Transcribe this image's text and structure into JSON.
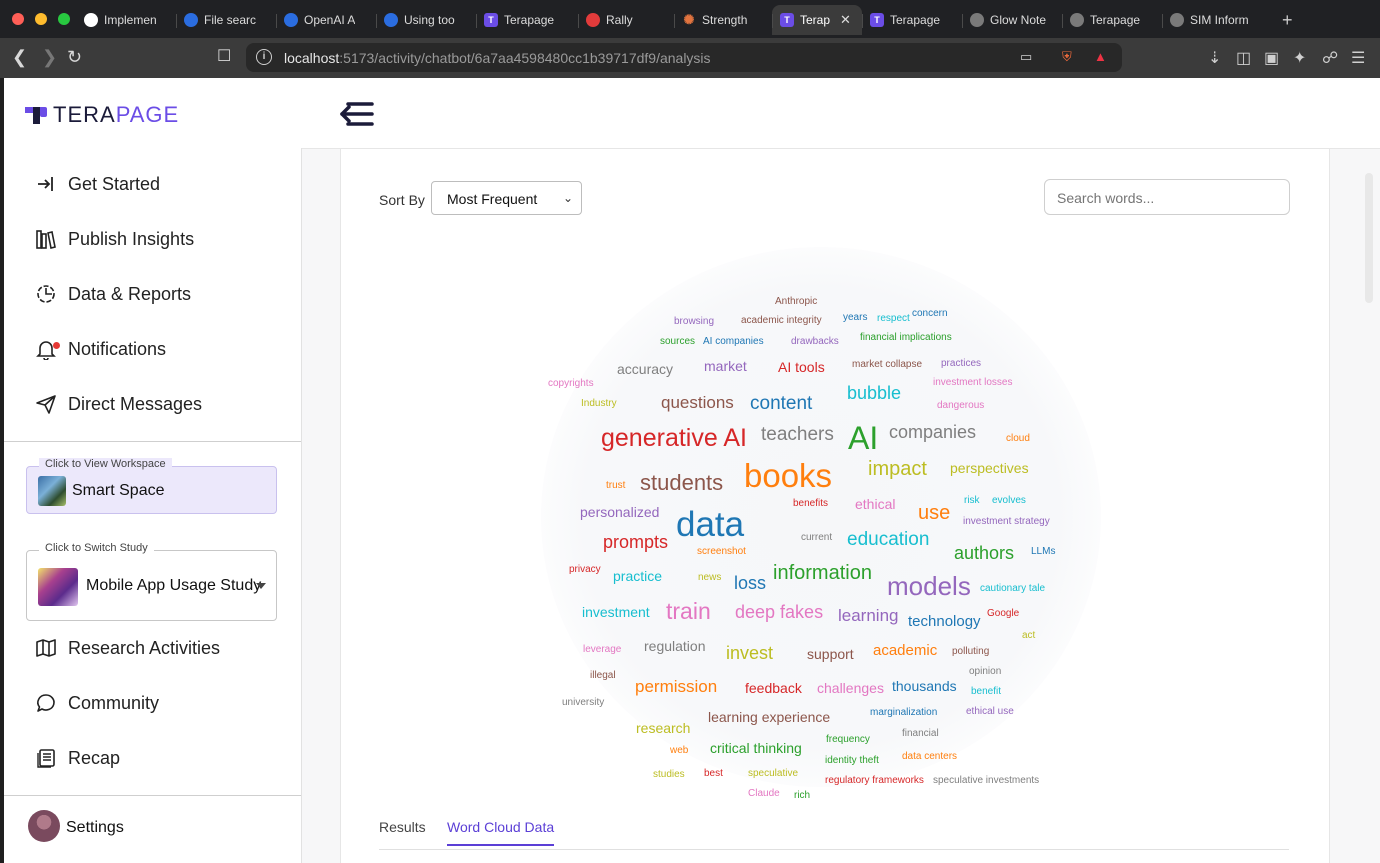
{
  "browser": {
    "tabs": [
      {
        "label": "Implemen",
        "icon": "github",
        "active": false
      },
      {
        "label": "File searc",
        "icon": "openai",
        "active": false
      },
      {
        "label": "OpenAI A",
        "icon": "openai",
        "active": false
      },
      {
        "label": "Using too",
        "icon": "openai",
        "active": false
      },
      {
        "label": "Terapage",
        "icon": "terapage",
        "active": false
      },
      {
        "label": "Rally",
        "icon": "rally",
        "active": false
      },
      {
        "label": "Strength",
        "icon": "claude",
        "active": false
      },
      {
        "label": "Terap",
        "icon": "terapage",
        "active": true
      },
      {
        "label": "Terapage",
        "icon": "terapage",
        "active": false
      },
      {
        "label": "Glow Note",
        "icon": "globe",
        "active": false
      },
      {
        "label": "Terapage",
        "icon": "globe",
        "active": false
      },
      {
        "label": "SIM Inform",
        "icon": "globe",
        "active": false
      }
    ],
    "new_tab": "+",
    "url_host": "localhost",
    "url_rest": ":5173/activity/chatbot/6a7aa4598480cc1b39717df9/analysis"
  },
  "header": {
    "logo_prefix": "TERA",
    "logo_suffix": "PAGE"
  },
  "sidebar": {
    "items": [
      {
        "label": "Get Started",
        "icon": "login-arrow-icon"
      },
      {
        "label": "Publish Insights",
        "icon": "books-icon"
      },
      {
        "label": "Data & Reports",
        "icon": "chart-pie-icon"
      },
      {
        "label": "Notifications",
        "icon": "bell-icon"
      },
      {
        "label": "Direct Messages",
        "icon": "send-icon"
      }
    ],
    "workspace_legend": "Click to View Workspace",
    "workspace_name": "Smart Space",
    "study_legend": "Click to Switch Study",
    "study_name": "Mobile App Usage Study",
    "items2": [
      {
        "label": "Research Activities",
        "icon": "map-icon"
      },
      {
        "label": "Community",
        "icon": "chat-bubble-icon"
      },
      {
        "label": "Recap",
        "icon": "recap-icon"
      }
    ],
    "settings_label": "Settings"
  },
  "toolbar": {
    "sort_label": "Sort By",
    "sort_value": "Most Frequent",
    "search_placeholder": "Search words..."
  },
  "content_tabs": {
    "results": "Results",
    "word_cloud_data": "Word Cloud Data"
  },
  "word_cloud": {
    "words": [
      {
        "text": "Anthropic",
        "size": 10,
        "color": "#8c564b"
      },
      {
        "text": "browsing",
        "size": 10,
        "color": "#9467bd"
      },
      {
        "text": "academic integrity",
        "size": 10,
        "color": "#8c564b"
      },
      {
        "text": "years",
        "size": 10,
        "color": "#1f77b4"
      },
      {
        "text": "respect",
        "size": 10,
        "color": "#17becf"
      },
      {
        "text": "concern",
        "size": 10,
        "color": "#1f77b4"
      },
      {
        "text": "sources",
        "size": 10,
        "color": "#2ca02c"
      },
      {
        "text": "AI companies",
        "size": 10,
        "color": "#1f77b4"
      },
      {
        "text": "drawbacks",
        "size": 10,
        "color": "#9467bd"
      },
      {
        "text": "financial implications",
        "size": 10,
        "color": "#2ca02c"
      },
      {
        "text": "accuracy",
        "size": 14,
        "color": "#7f7f7f"
      },
      {
        "text": "market",
        "size": 14,
        "color": "#9467bd"
      },
      {
        "text": "AI tools",
        "size": 14,
        "color": "#d62728"
      },
      {
        "text": "market collapse",
        "size": 10,
        "color": "#8c564b"
      },
      {
        "text": "practices",
        "size": 10,
        "color": "#9467bd"
      },
      {
        "text": "copyrights",
        "size": 10,
        "color": "#e377c2"
      },
      {
        "text": "investment losses",
        "size": 10,
        "color": "#e377c2"
      },
      {
        "text": "Industry",
        "size": 10,
        "color": "#bcbd22"
      },
      {
        "text": "questions",
        "size": 17,
        "color": "#8c564b"
      },
      {
        "text": "content",
        "size": 19,
        "color": "#1f77b4"
      },
      {
        "text": "bubble",
        "size": 18,
        "color": "#17becf"
      },
      {
        "text": "dangerous",
        "size": 10,
        "color": "#e377c2"
      },
      {
        "text": "generative AI",
        "size": 25,
        "color": "#d62728"
      },
      {
        "text": "teachers",
        "size": 19,
        "color": "#7f7f7f"
      },
      {
        "text": "AI",
        "size": 32,
        "color": "#2ca02c"
      },
      {
        "text": "companies",
        "size": 18,
        "color": "#7f7f7f"
      },
      {
        "text": "cloud",
        "size": 10,
        "color": "#ff7f0e"
      },
      {
        "text": "books",
        "size": 33,
        "color": "#ff7f0e"
      },
      {
        "text": "impact",
        "size": 20,
        "color": "#bcbd22"
      },
      {
        "text": "perspectives",
        "size": 14,
        "color": "#bcbd22"
      },
      {
        "text": "trust",
        "size": 10,
        "color": "#ff7f0e"
      },
      {
        "text": "students",
        "size": 22,
        "color": "#8c564b"
      },
      {
        "text": "benefits",
        "size": 10,
        "color": "#d62728"
      },
      {
        "text": "ethical",
        "size": 14,
        "color": "#e377c2"
      },
      {
        "text": "use",
        "size": 20,
        "color": "#ff7f0e"
      },
      {
        "text": "risk",
        "size": 10,
        "color": "#17becf"
      },
      {
        "text": "evolves",
        "size": 10,
        "color": "#17becf"
      },
      {
        "text": "personalized",
        "size": 14,
        "color": "#9467bd"
      },
      {
        "text": "data",
        "size": 35,
        "color": "#1f77b4"
      },
      {
        "text": "investment strategy",
        "size": 10,
        "color": "#9467bd"
      },
      {
        "text": "current",
        "size": 10,
        "color": "#7f7f7f"
      },
      {
        "text": "education",
        "size": 19,
        "color": "#17becf"
      },
      {
        "text": "prompts",
        "size": 18,
        "color": "#d62728"
      },
      {
        "text": "screenshot",
        "size": 10,
        "color": "#ff7f0e"
      },
      {
        "text": "authors",
        "size": 18,
        "color": "#2ca02c"
      },
      {
        "text": "LLMs",
        "size": 10,
        "color": "#1f77b4"
      },
      {
        "text": "privacy",
        "size": 10,
        "color": "#d62728"
      },
      {
        "text": "practice",
        "size": 14,
        "color": "#17becf"
      },
      {
        "text": "news",
        "size": 10,
        "color": "#bcbd22"
      },
      {
        "text": "loss",
        "size": 18,
        "color": "#1f77b4"
      },
      {
        "text": "information",
        "size": 20,
        "color": "#2ca02c"
      },
      {
        "text": "models",
        "size": 26,
        "color": "#9467bd"
      },
      {
        "text": "cautionary tale",
        "size": 10,
        "color": "#17becf"
      },
      {
        "text": "investment",
        "size": 14,
        "color": "#17becf"
      },
      {
        "text": "train",
        "size": 23,
        "color": "#e377c2"
      },
      {
        "text": "deep fakes",
        "size": 18,
        "color": "#e377c2"
      },
      {
        "text": "learning",
        "size": 17,
        "color": "#9467bd"
      },
      {
        "text": "technology",
        "size": 15,
        "color": "#1f77b4"
      },
      {
        "text": "Google",
        "size": 10,
        "color": "#d62728"
      },
      {
        "text": "act",
        "size": 10,
        "color": "#bcbd22"
      },
      {
        "text": "leverage",
        "size": 10,
        "color": "#e377c2"
      },
      {
        "text": "regulation",
        "size": 14,
        "color": "#7f7f7f"
      },
      {
        "text": "invest",
        "size": 18,
        "color": "#bcbd22"
      },
      {
        "text": "support",
        "size": 14,
        "color": "#8c564b"
      },
      {
        "text": "academic",
        "size": 15,
        "color": "#ff7f0e"
      },
      {
        "text": "polluting",
        "size": 10,
        "color": "#8c564b"
      },
      {
        "text": "illegal",
        "size": 10,
        "color": "#8c564b"
      },
      {
        "text": "opinion",
        "size": 10,
        "color": "#7f7f7f"
      },
      {
        "text": "permission",
        "size": 17,
        "color": "#ff7f0e"
      },
      {
        "text": "feedback",
        "size": 14,
        "color": "#d62728"
      },
      {
        "text": "challenges",
        "size": 14,
        "color": "#e377c2"
      },
      {
        "text": "thousands",
        "size": 14,
        "color": "#1f77b4"
      },
      {
        "text": "benefit",
        "size": 10,
        "color": "#17becf"
      },
      {
        "text": "university",
        "size": 10,
        "color": "#7f7f7f"
      },
      {
        "text": "marginalization",
        "size": 10,
        "color": "#1f77b4"
      },
      {
        "text": "ethical use",
        "size": 10,
        "color": "#9467bd"
      },
      {
        "text": "learning experience",
        "size": 14,
        "color": "#8c564b"
      },
      {
        "text": "research",
        "size": 14,
        "color": "#bcbd22"
      },
      {
        "text": "financial",
        "size": 10,
        "color": "#7f7f7f"
      },
      {
        "text": "critical thinking",
        "size": 14,
        "color": "#2ca02c"
      },
      {
        "text": "frequency",
        "size": 10,
        "color": "#2ca02c"
      },
      {
        "text": "web",
        "size": 10,
        "color": "#ff7f0e"
      },
      {
        "text": "identity theft",
        "size": 10,
        "color": "#2ca02c"
      },
      {
        "text": "data centers",
        "size": 10,
        "color": "#ff7f0e"
      },
      {
        "text": "studies",
        "size": 10,
        "color": "#bcbd22"
      },
      {
        "text": "best",
        "size": 10,
        "color": "#d62728"
      },
      {
        "text": "speculative",
        "size": 10,
        "color": "#bcbd22"
      },
      {
        "text": "regulatory frameworks",
        "size": 10,
        "color": "#d62728"
      },
      {
        "text": "speculative investments",
        "size": 10,
        "color": "#7f7f7f"
      },
      {
        "text": "Claude",
        "size": 10,
        "color": "#e377c2"
      },
      {
        "text": "rich",
        "size": 10,
        "color": "#2ca02c"
      }
    ]
  }
}
